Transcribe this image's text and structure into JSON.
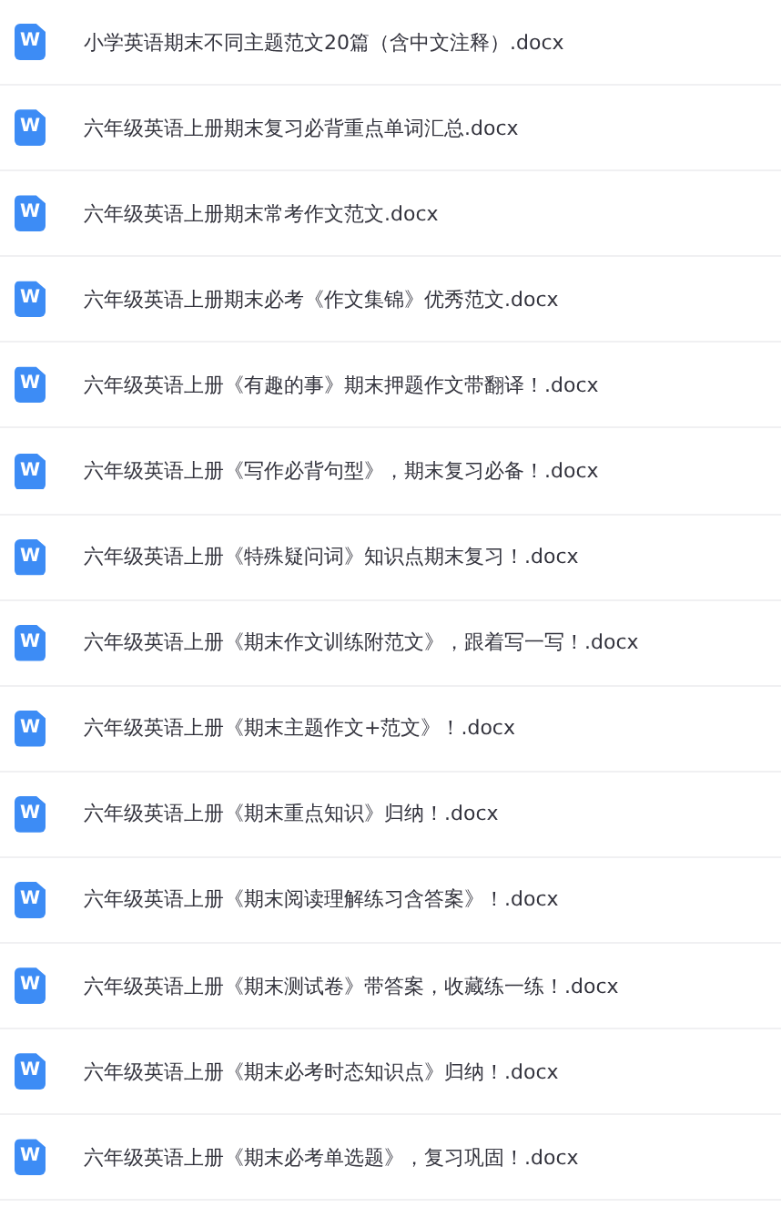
{
  "files": [
    {
      "icon_letter": "W",
      "name": "小学英语期末不同主题范文20篇（含中文注释）.docx"
    },
    {
      "icon_letter": "W",
      "name": "六年级英语上册期末复习必背重点单词汇总.docx"
    },
    {
      "icon_letter": "W",
      "name": "六年级英语上册期末常考作文范文.docx"
    },
    {
      "icon_letter": "W",
      "name": "六年级英语上册期末必考《作文集锦》优秀范文.docx"
    },
    {
      "icon_letter": "W",
      "name": "六年级英语上册《有趣的事》期末押题作文带翻译！.docx"
    },
    {
      "icon_letter": "W",
      "name": "六年级英语上册《写作必背句型》，期末复习必备！.docx"
    },
    {
      "icon_letter": "W",
      "name": "六年级英语上册《特殊疑问词》知识点期末复习！.docx"
    },
    {
      "icon_letter": "W",
      "name": "六年级英语上册《期末作文训练附范文》，跟着写一写！.docx"
    },
    {
      "icon_letter": "W",
      "name": "六年级英语上册《期末主题作文+范文》！.docx"
    },
    {
      "icon_letter": "W",
      "name": "六年级英语上册《期末重点知识》归纳！.docx"
    },
    {
      "icon_letter": "W",
      "name": "六年级英语上册《期末阅读理解练习含答案》！.docx"
    },
    {
      "icon_letter": "W",
      "name": "六年级英语上册《期末测试卷》带答案，收藏练一练！.docx"
    },
    {
      "icon_letter": "W",
      "name": "六年级英语上册《期末必考时态知识点》归纳！.docx"
    },
    {
      "icon_letter": "W",
      "name": "六年级英语上册《期末必考单选题》，复习巩固！.docx"
    }
  ]
}
